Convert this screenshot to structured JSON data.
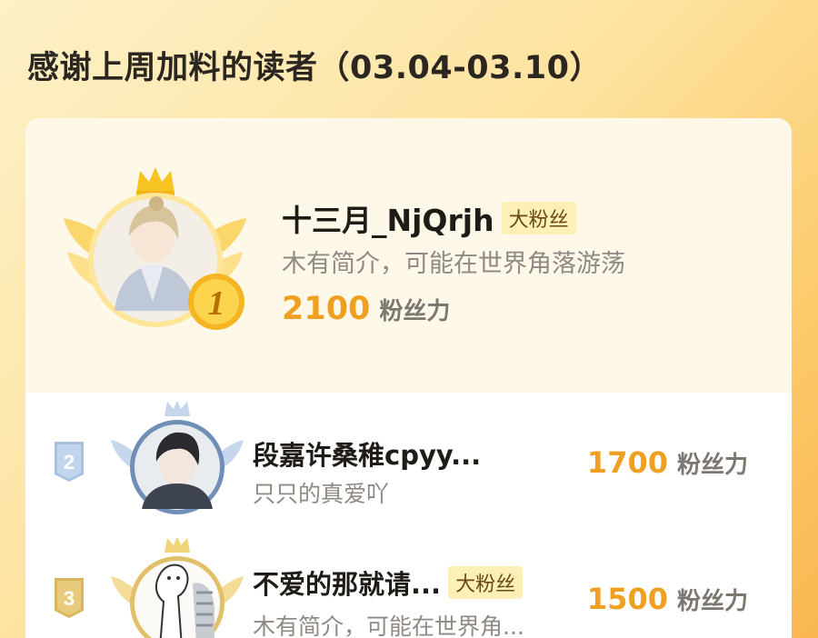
{
  "page": {
    "title": "感谢上周加料的读者（03.04-03.10）"
  },
  "ranking": [
    {
      "rank": "1",
      "name": "十三月_NjQrjh",
      "badge": "大粉丝",
      "bio": "木有简介，可能在世界角落游荡",
      "score": "2100",
      "score_unit": "粉丝力"
    },
    {
      "rank": "2",
      "name": "段嘉许桑稚cpyy...",
      "badge": "",
      "bio": "只只的真爱吖",
      "score": "1700",
      "score_unit": "粉丝力"
    },
    {
      "rank": "3",
      "name": "不爱的那就请...",
      "badge": "大粉丝",
      "bio": "木有简介，可能在世界角...",
      "score": "1500",
      "score_unit": "粉丝力"
    }
  ],
  "colors": {
    "accent_score": "#f0a020",
    "badge_bg": "#fcefb8",
    "gold": "#f5c030",
    "silver": "#a9c1df",
    "bronze": "#e2c06a"
  }
}
